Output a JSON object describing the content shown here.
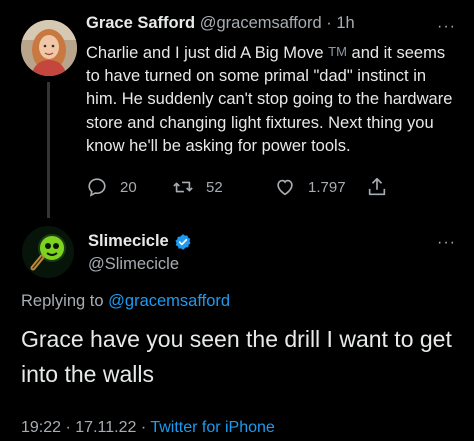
{
  "tweet": {
    "author_name": "Grace Safford",
    "author_handle": "@gracemsafford",
    "separator": "·",
    "time": "1h",
    "text_before_tm": "Charlie and I just did A Big Move",
    "tm": "TM",
    "text_after_tm": " and it seems to have turned on some primal \"dad\" instinct in him. He suddenly can't stop going to the hardware store and changing light fixtures. Next thing you know he'll be asking for power tools.",
    "reply_count": "20",
    "retweet_count": "52",
    "like_count": "1.797",
    "more": "···"
  },
  "reply": {
    "author_name": "Slimecicle",
    "author_handle": "@Slimecicle",
    "verified": true,
    "more": "···",
    "replying_to_label": "Replying to",
    "replying_to_handle": "@gracemsafford",
    "text": "Grace have you seen the drill I want to get into the walls",
    "time": "19:22",
    "date": "17.11.22",
    "separator": "·",
    "client": "Twitter for iPhone"
  },
  "colors": {
    "background": "#000000",
    "text": "#e7e9ea",
    "secondary": "#a7adb2",
    "link": "#1d9bf0",
    "thread_line": "#333639",
    "slime_green": "#7ed321"
  },
  "icons": [
    "reply-icon",
    "retweet-icon",
    "like-icon",
    "share-icon",
    "verified-icon",
    "more-icon"
  ]
}
